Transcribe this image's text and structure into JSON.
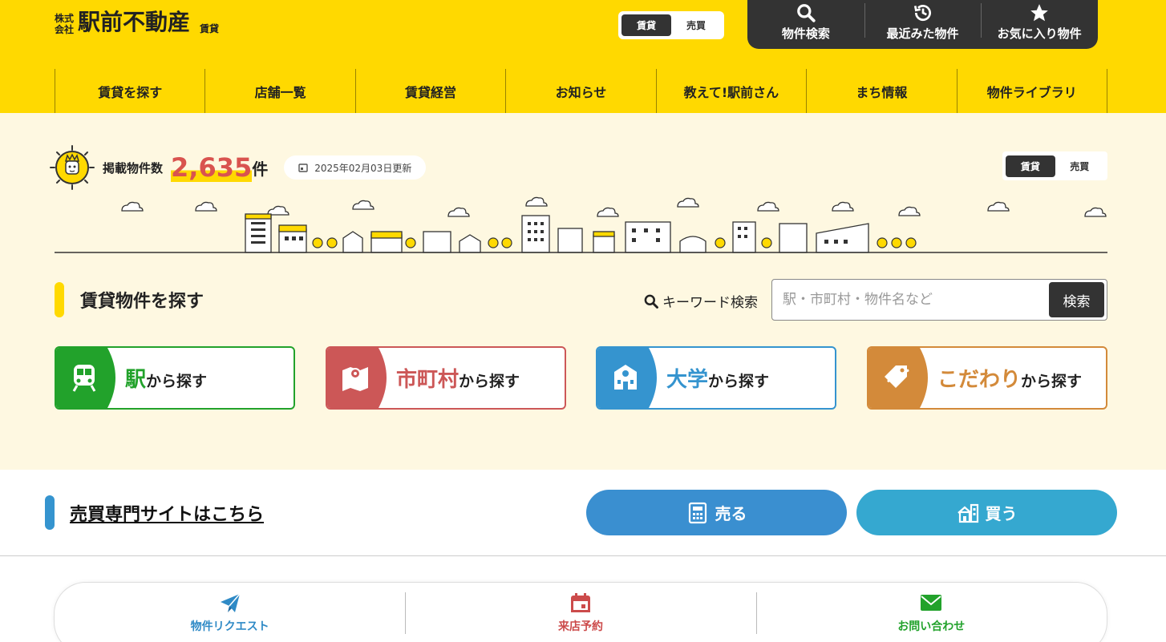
{
  "logo": {
    "kabu_line1": "株式",
    "kabu_line2": "会社",
    "name": "駅前不動産",
    "tag": "賃貸"
  },
  "top_switch": {
    "rent": "賃貸",
    "sale": "売買"
  },
  "quick": {
    "search": "物件検索",
    "recent": "最近みた物件",
    "favorite": "お気に入り物件"
  },
  "nav": [
    "賃貸を探す",
    "店舗一覧",
    "賃貸経営",
    "お知らせ",
    "教えて!駅前さん",
    "まち情報",
    "物件ライブラリ"
  ],
  "listing": {
    "label": "掲載物件数",
    "count": "2,635",
    "unit": "件",
    "updated": "2025年02月03日更新"
  },
  "hero_switch": {
    "rent": "賃貸",
    "sale": "売買"
  },
  "search_section": {
    "title": "賃貸物件を探す",
    "keyword_label": "キーワード検索",
    "placeholder": "駅・市町村・物件名など",
    "button": "検索"
  },
  "cards": [
    {
      "highlight": "駅",
      "suffix": "から探す"
    },
    {
      "highlight": "市町村",
      "suffix": "から探す"
    },
    {
      "highlight": "大学",
      "suffix": "から探す"
    },
    {
      "highlight": "こだわり",
      "suffix": "から探す"
    }
  ],
  "sales": {
    "link": "売買専門サイトはこちら",
    "sell": "売る",
    "buy": "買う"
  },
  "actions": {
    "request": "物件リクエスト",
    "visit": "来店予約",
    "contact": "お問い合わせ"
  },
  "colors": {
    "brand_yellow": "#ffd900",
    "hero_bg": "#fef8e1",
    "dark": "#333333",
    "station_green": "#22a22b",
    "city_red": "#cc5757",
    "univ_blue": "#3594cf",
    "pref_orange": "#d38a3a"
  }
}
